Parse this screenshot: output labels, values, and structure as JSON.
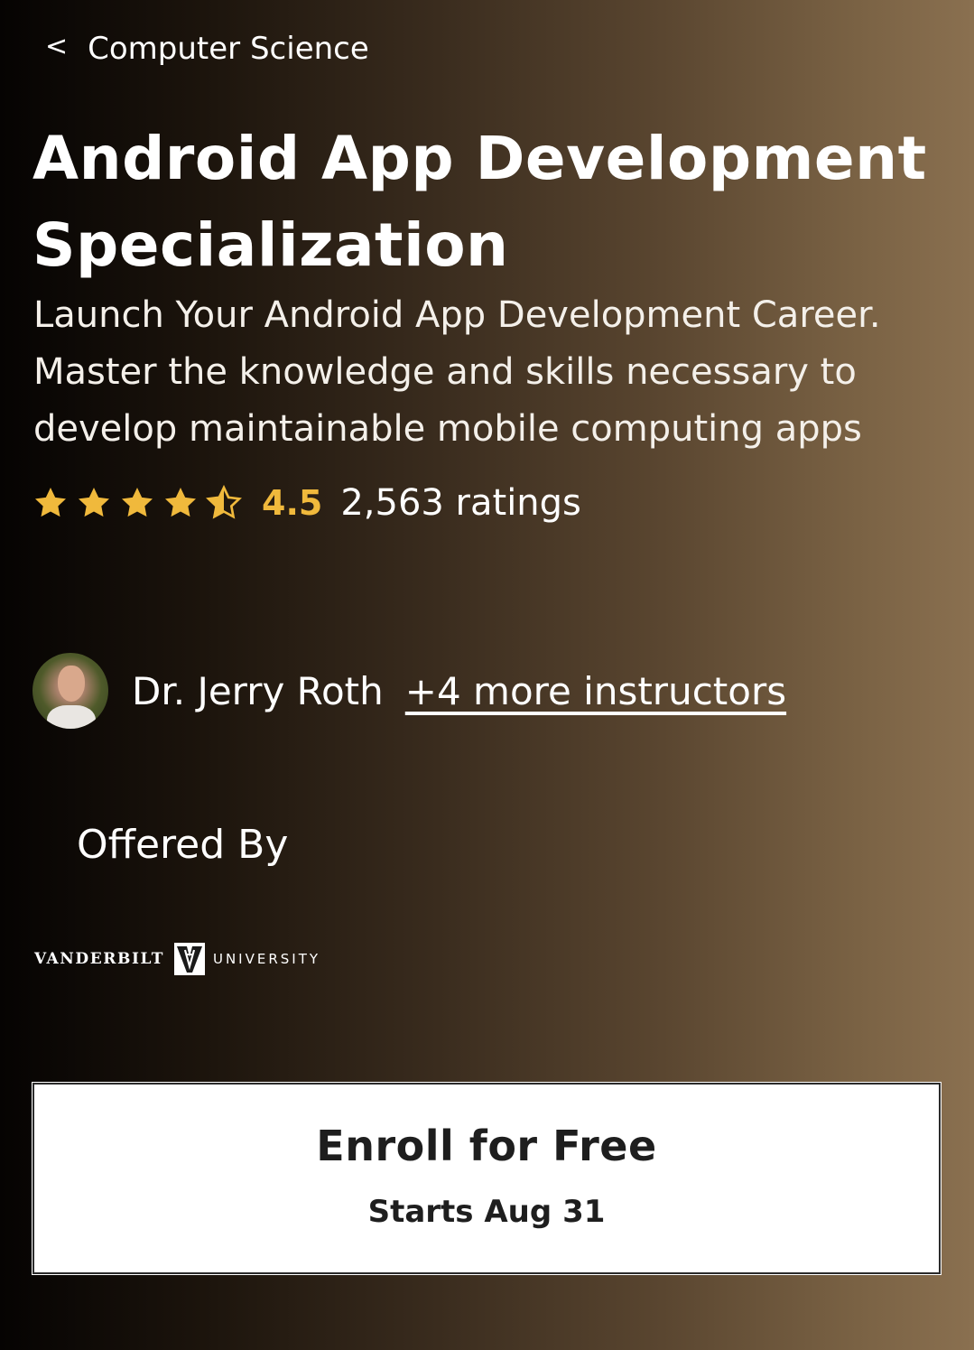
{
  "breadcrumb": {
    "back_glyph": "<",
    "label": "Computer Science"
  },
  "course": {
    "title": "Android App Development Specialization",
    "description": "Launch Your Android App Development Career. Master the knowledge and skills necessary to develop maintainable mobile computing apps"
  },
  "rating": {
    "value": "4.5",
    "count_label": "2,563 ratings",
    "stars": 4.5,
    "star_color": "#f0b93c"
  },
  "instructors": {
    "primary_name": "Dr. Jerry Roth",
    "more_label": "+4 more instructors"
  },
  "offered_by": {
    "heading": "Offered By",
    "logo": {
      "left_word": "VANDERBILT",
      "right_word": "UNIVERSITY"
    }
  },
  "enroll": {
    "label": "Enroll for Free",
    "sub_label": "Starts Aug 31"
  }
}
